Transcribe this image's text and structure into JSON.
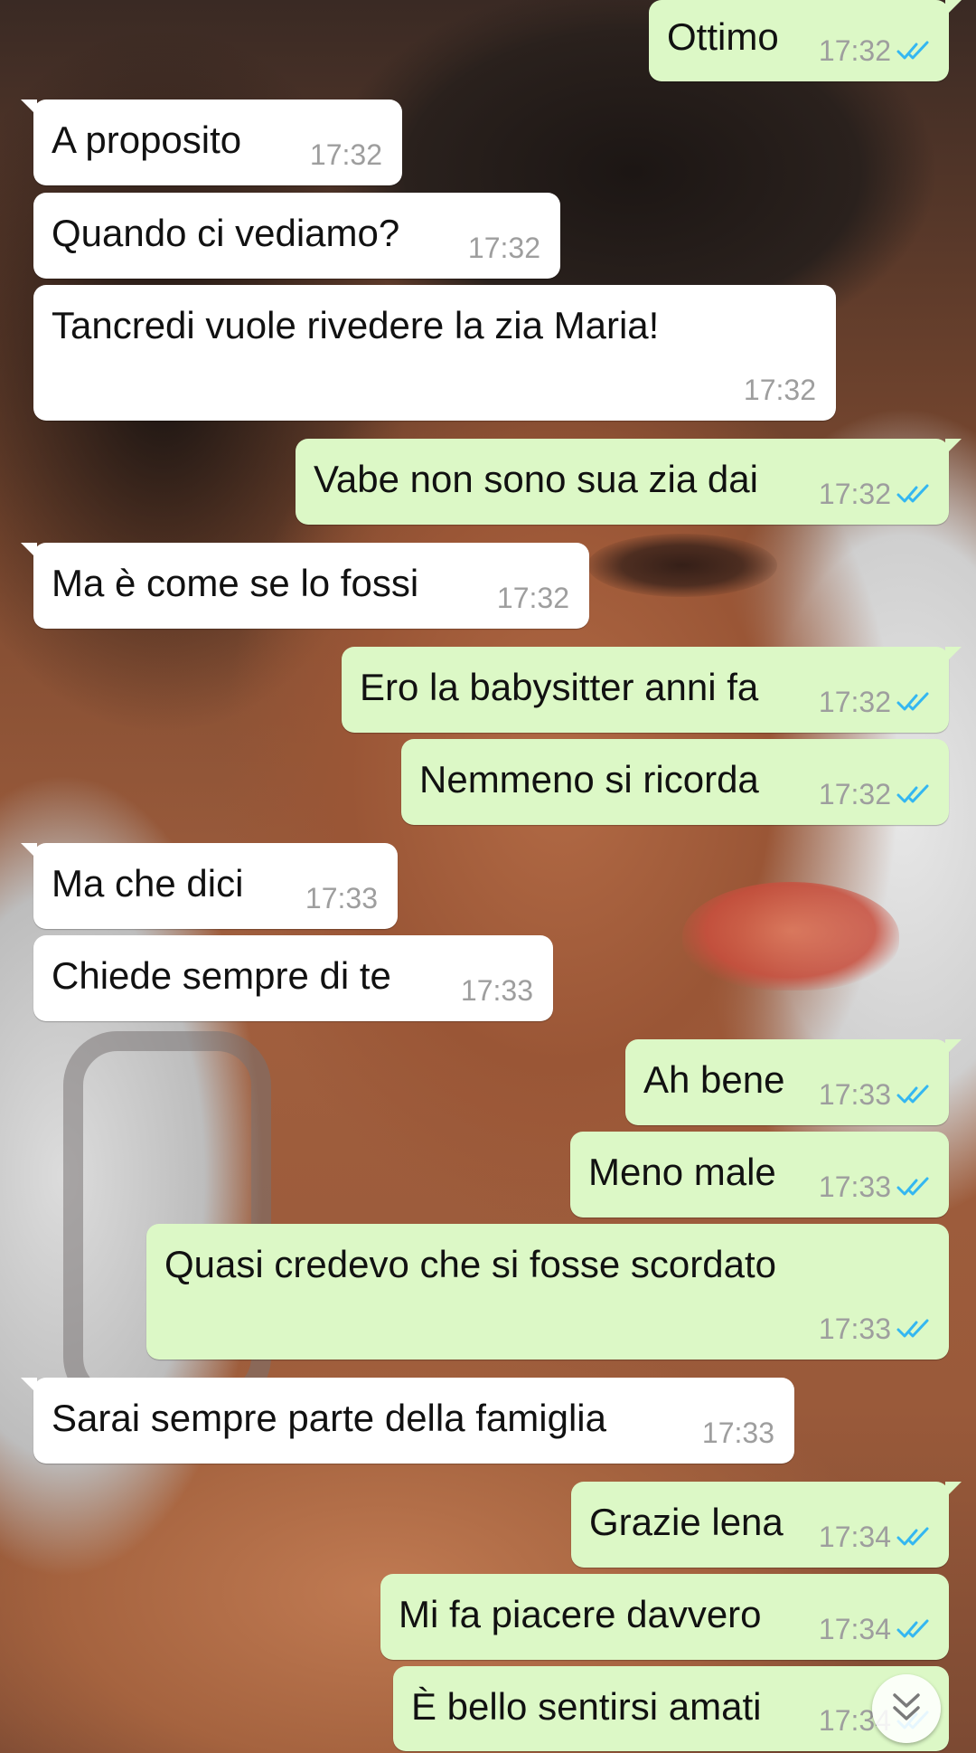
{
  "messages": [
    {
      "dir": "out",
      "text": "Ottimo",
      "time": "17:32",
      "read": true
    },
    {
      "dir": "in",
      "text": "A proposito",
      "time": "17:32"
    },
    {
      "dir": "in",
      "text": "Quando ci vediamo?",
      "time": "17:32"
    },
    {
      "dir": "in",
      "text": "Tancredi vuole rivedere la zia Maria!",
      "time": "17:32"
    },
    {
      "dir": "out",
      "text": "Vabe non sono sua zia dai",
      "time": "17:32",
      "read": true
    },
    {
      "dir": "in",
      "text": "Ma è come se lo fossi",
      "time": "17:32"
    },
    {
      "dir": "out",
      "text": "Ero la babysitter anni fa",
      "time": "17:32",
      "read": true
    },
    {
      "dir": "out",
      "text": "Nemmeno si ricorda",
      "time": "17:32",
      "read": true
    },
    {
      "dir": "in",
      "text": "Ma che dici",
      "time": "17:33"
    },
    {
      "dir": "in",
      "text": "Chiede sempre di te",
      "time": "17:33"
    },
    {
      "dir": "out",
      "text": "Ah bene",
      "time": "17:33",
      "read": true
    },
    {
      "dir": "out",
      "text": "Meno male",
      "time": "17:33",
      "read": true
    },
    {
      "dir": "out",
      "text": "Quasi credevo che si fosse scordato",
      "time": "17:33",
      "read": true
    },
    {
      "dir": "in",
      "text": "Sarai sempre parte della famiglia",
      "time": "17:33"
    },
    {
      "dir": "out",
      "text": "Grazie lena",
      "time": "17:34",
      "read": true
    },
    {
      "dir": "out",
      "text": "Mi fa piacere davvero",
      "time": "17:34",
      "read": true
    },
    {
      "dir": "out",
      "text": "È bello sentirsi amati",
      "time": "17:34",
      "read": true
    }
  ],
  "colors": {
    "incoming_bubble": "#ffffff",
    "outgoing_bubble": "#dcf8c6",
    "read_ticks": "#34b7f1",
    "timestamp": "#9e9e9e"
  },
  "icons": {
    "read_receipt": "double-check-icon",
    "scroll": "double-chevron-down-icon"
  }
}
